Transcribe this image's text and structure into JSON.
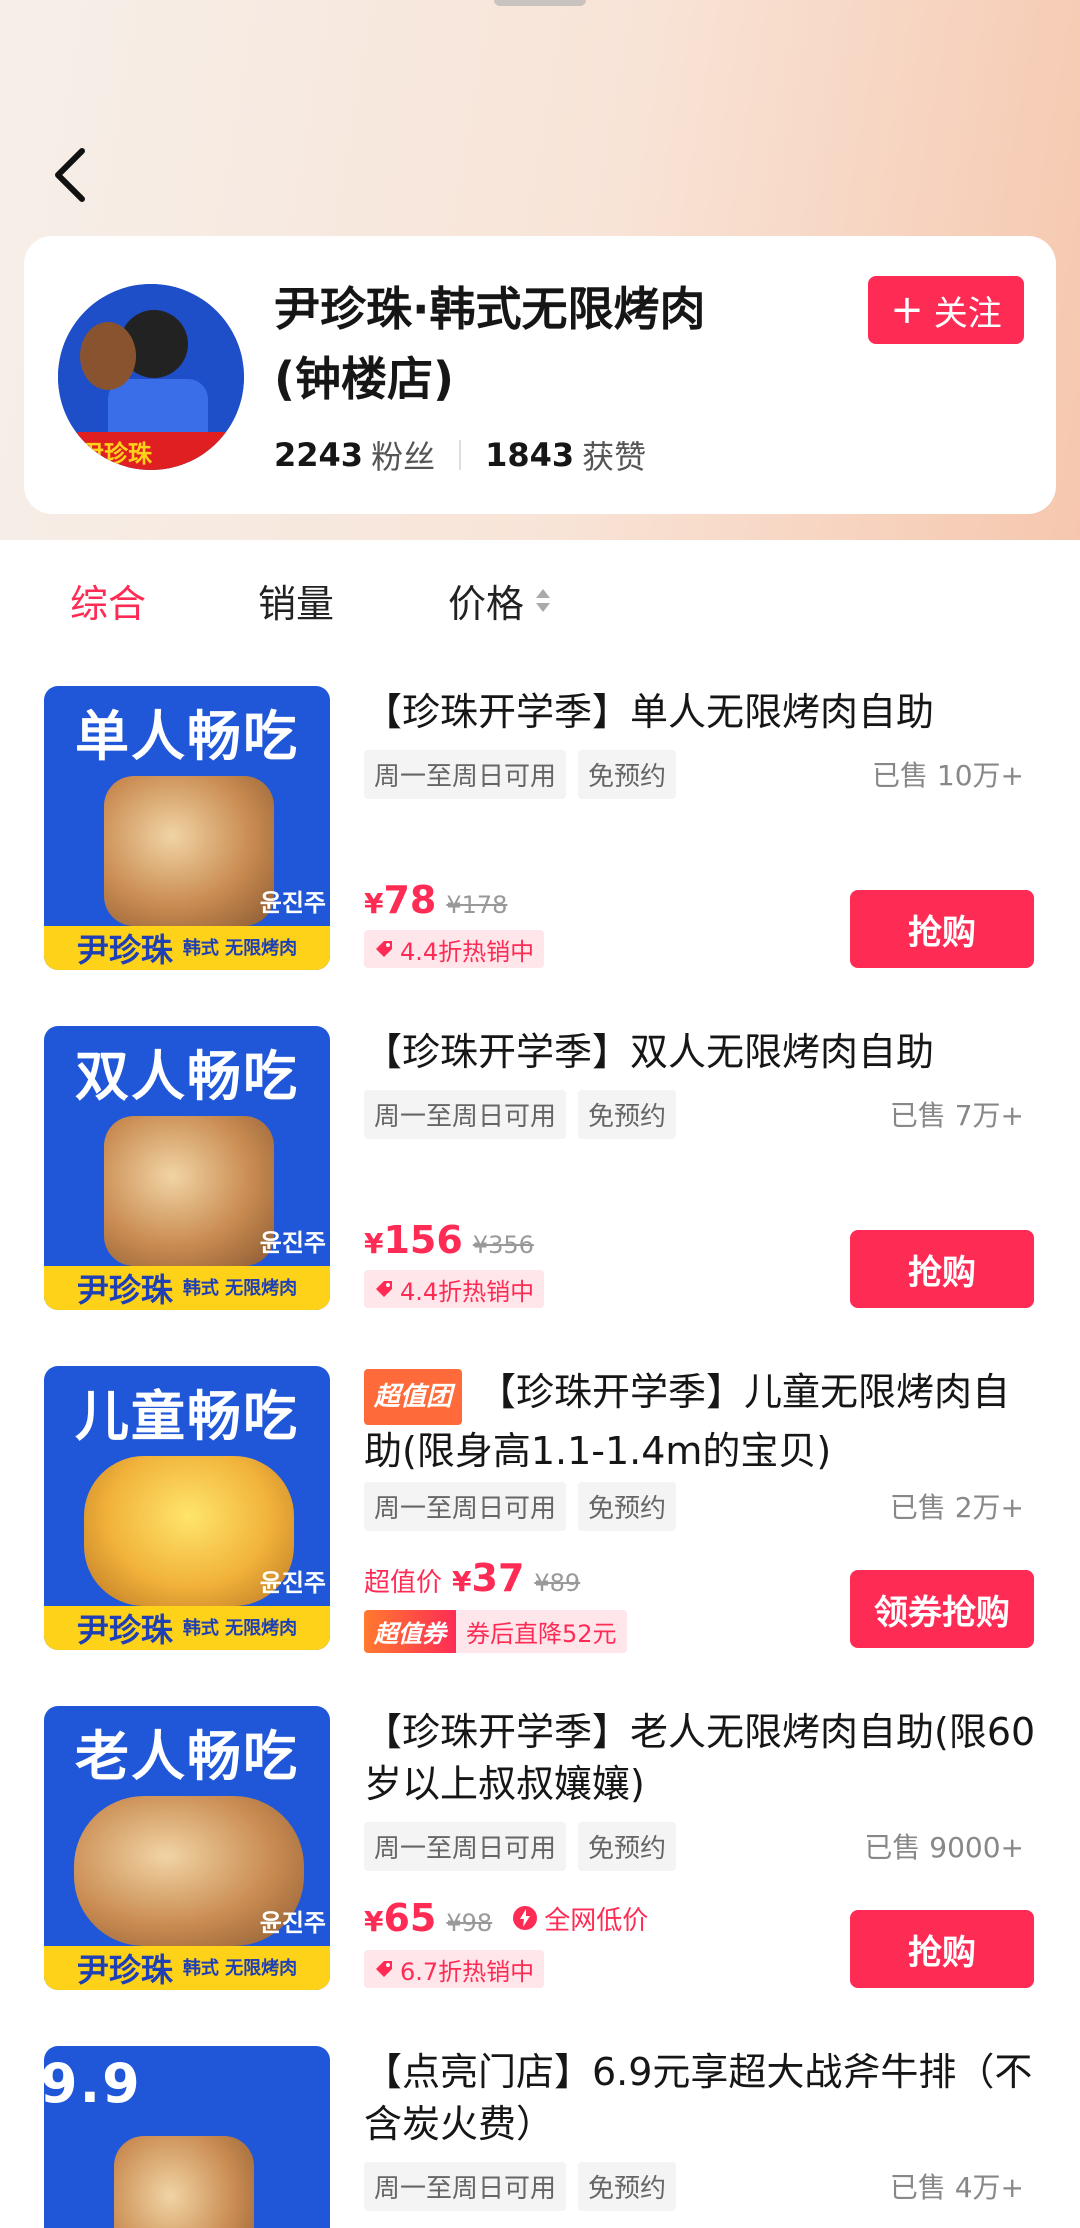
{
  "shop": {
    "name_line1": "尹珍珠·韩式无限烤肉",
    "name_line2": "(钟楼店)",
    "follow_label": "关注",
    "fans_num": "2243",
    "fans_unit": "粉丝",
    "likes_num": "1843",
    "likes_unit": "获赞",
    "avatar_text": "尹珍珠"
  },
  "sort_tabs": [
    "综合",
    "销量",
    "价格"
  ],
  "products": [
    {
      "thumb_title": "单人畅吃",
      "title": "【珍珠开学季】单人无限烤肉自助",
      "tags": [
        "周一至周日可用",
        "免预约"
      ],
      "sold": "已售 10万+",
      "price_yen": "¥",
      "price": "78",
      "orig": "¥178",
      "discount": "4.4折热销中",
      "button": "抢购"
    },
    {
      "thumb_title": "双人畅吃",
      "title": "【珍珠开学季】双人无限烤肉自助",
      "tags": [
        "周一至周日可用",
        "免预约"
      ],
      "sold": "已售 7万+",
      "price_yen": "¥",
      "price": "156",
      "orig": "¥356",
      "discount": "4.4折热销中",
      "button": "抢购"
    },
    {
      "thumb_title": "儿童畅吃",
      "badge": "超值团",
      "title": "【珍珠开学季】儿童无限烤肉自助(限身高1.1-1.4m的宝贝)",
      "tags": [
        "周一至周日可用",
        "免预约"
      ],
      "sold": "已售 2万+",
      "pre_price": "超值价",
      "price_yen": "¥",
      "price": "37",
      "orig": "¥89",
      "coupon_badge": "超值券",
      "coupon_text": "券后直降52元",
      "button": "领券抢购"
    },
    {
      "thumb_title": "老人畅吃",
      "title": "【珍珠开学季】老人无限烤肉自助(限60岁以上叔叔孃孃)",
      "tags": [
        "周一至周日可用",
        "免预约"
      ],
      "sold": "已售 9000+",
      "price_yen": "¥",
      "price": "65",
      "orig": "¥98",
      "lowest": "全网低价",
      "discount": "6.7折热销中",
      "button": "抢购"
    },
    {
      "thumb_title": "9.9",
      "title": "【点亮门店】6.9元享超大战斧牛排（不含炭火费）",
      "tags": [
        "周一至周日可用",
        "免预约"
      ],
      "sold": "已售 4万+"
    }
  ],
  "thumb_brand": "尹珍珠",
  "thumb_brand_sub": "韩式 无限烤肉",
  "thumb_korean": "윤진주",
  "colors": {
    "accent": "#fe2c55",
    "thumb_blue": "#1f57d8",
    "ribbon_yellow": "#ffd21a"
  }
}
